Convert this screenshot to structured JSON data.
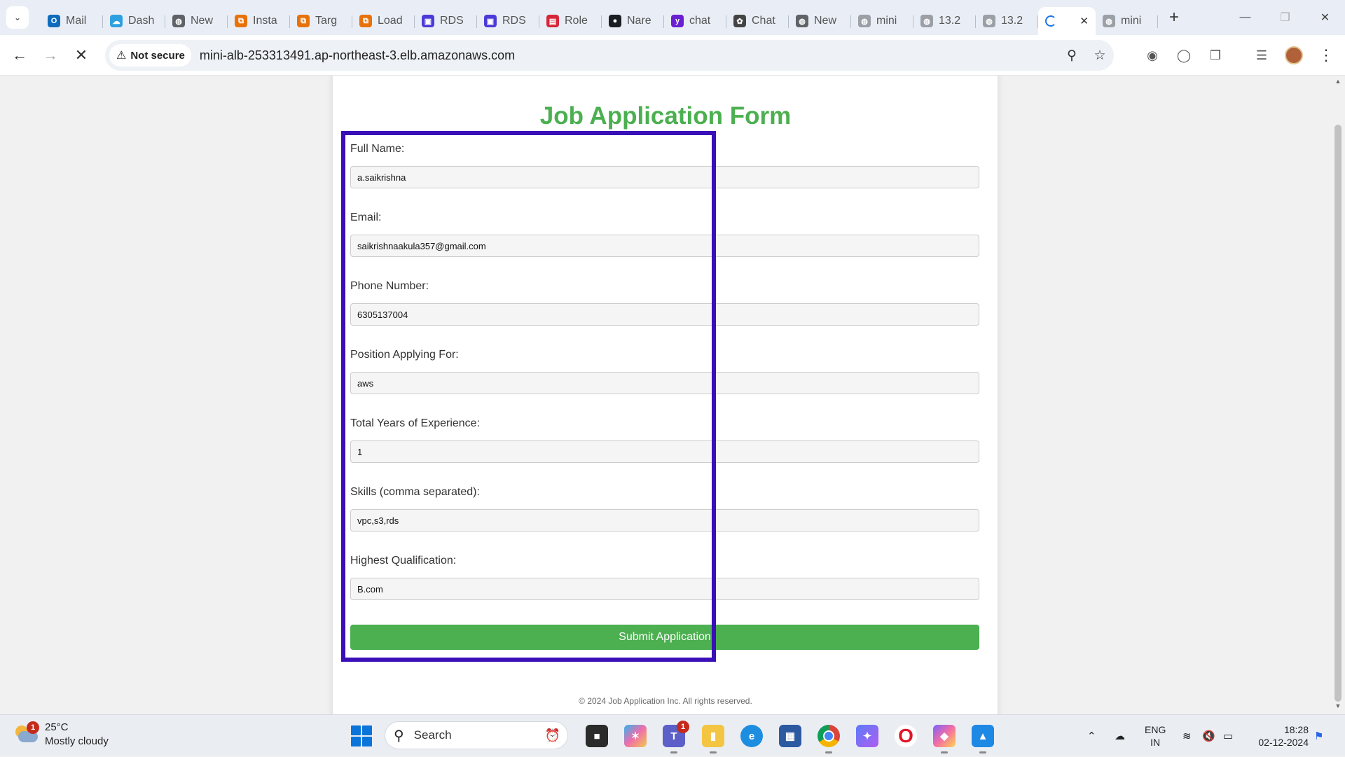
{
  "browser": {
    "tabs": [
      {
        "title": "Mail",
        "color": "#0f6cbd",
        "glyph": "O"
      },
      {
        "title": "Dash",
        "color": "#2ea0e0",
        "glyph": "☁"
      },
      {
        "title": "New",
        "color": "#5f6368",
        "glyph": "◍"
      },
      {
        "title": "Insta",
        "color": "#e8710a",
        "glyph": "⧉"
      },
      {
        "title": "Targ",
        "color": "#e8710a",
        "glyph": "⧉"
      },
      {
        "title": "Load",
        "color": "#e8710a",
        "glyph": "⧉"
      },
      {
        "title": "RDS",
        "color": "#4b3bd6",
        "glyph": "▣"
      },
      {
        "title": "RDS",
        "color": "#4b3bd6",
        "glyph": "▣"
      },
      {
        "title": "Role",
        "color": "#d6263a",
        "glyph": "▤"
      },
      {
        "title": "Nare",
        "color": "#1b1f23",
        "glyph": "●"
      },
      {
        "title": "chat",
        "color": "#6a1fd1",
        "glyph": "y"
      },
      {
        "title": "Chat",
        "color": "#444444",
        "glyph": "✿"
      },
      {
        "title": "New",
        "color": "#5f6368",
        "glyph": "◍"
      },
      {
        "title": "mini",
        "color": "#9aa0a6",
        "glyph": "◍"
      },
      {
        "title": "13.2",
        "color": "#9aa0a6",
        "glyph": "◍"
      },
      {
        "title": "13.2",
        "color": "#9aa0a6",
        "glyph": "◍"
      }
    ],
    "active_tab": {
      "title": "",
      "loading": true
    },
    "last_tab": {
      "title": "mini",
      "color": "#9aa0a6",
      "glyph": "◍"
    },
    "security_label": "Not secure",
    "url": "mini-alb-253313491.ap-northeast-3.elb.amazonaws.com"
  },
  "form": {
    "title": "Job Application Form",
    "fields": [
      {
        "label": "Full Name:",
        "value": "a.saikrishna"
      },
      {
        "label": "Email:",
        "value": "saikrishnaakula357@gmail.com"
      },
      {
        "label": "Phone Number:",
        "value": "6305137004"
      },
      {
        "label": "Position Applying For:",
        "value": "aws"
      },
      {
        "label": "Total Years of Experience:",
        "value": "1"
      },
      {
        "label": "Skills (comma separated):",
        "value": "vpc,s3,rds"
      },
      {
        "label": "Highest Qualification:",
        "value": "B.com"
      }
    ],
    "submit_label": "Submit Application",
    "highlight_color": "#3a0fb8"
  },
  "footer": {
    "text": "© 2024 Job Application Inc. All rights reserved."
  },
  "taskbar": {
    "weather": {
      "temp": "25°C",
      "condition": "Mostly cloudy",
      "badge": "1"
    },
    "search_label": "Search",
    "teams_badge": "1",
    "language": {
      "line1": "ENG",
      "line2": "IN"
    },
    "clock": {
      "time": "18:28",
      "date": "02-12-2024"
    }
  }
}
